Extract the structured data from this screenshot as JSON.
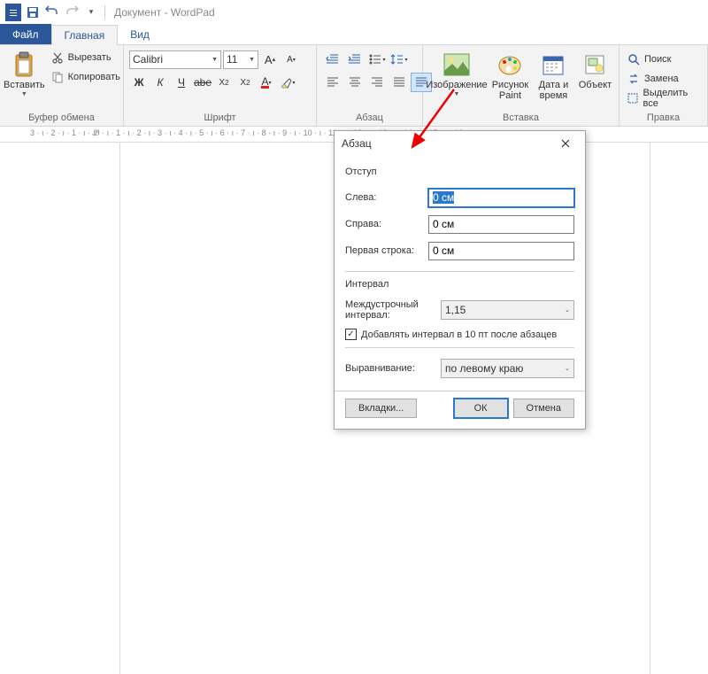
{
  "app": {
    "title": "Документ - WordPad"
  },
  "tabs": {
    "file": "Файл",
    "home": "Главная",
    "view": "Вид"
  },
  "clipboard": {
    "paste": "Вставить",
    "cut": "Вырезать",
    "copy": "Копировать",
    "group": "Буфер обмена"
  },
  "font": {
    "name": "Calibri",
    "size": "11",
    "group": "Шрифт"
  },
  "paragraph": {
    "group": "Абзац"
  },
  "insert": {
    "image": "Изображение",
    "paint": "Рисунок Paint",
    "datetime": "Дата и время",
    "object": "Объект",
    "group": "Вставка"
  },
  "editing": {
    "find": "Поиск",
    "replace": "Замена",
    "selectall": "Выделить все",
    "group": "Правка"
  },
  "ruler": "3 · ı · 2 · ı · 1 · ı · Ꮺ · ı · 1 · ı · 2 · ı · 3 · ı · 4 · ı · 5 · ı · 6 · ı · 7 · ı · 8 · ı · 9 · ı · 10 · ı · 11 · ı · 12 · ı · 13 · ı · 14 · ı · 15 · ı · 16 · ı ·",
  "dialog": {
    "title": "Абзац",
    "indent_section": "Отступ",
    "left_label": "Слева:",
    "left_value": "0 см",
    "right_label": "Справа:",
    "right_value": "0 см",
    "firstline_label": "Первая строка:",
    "firstline_value": "0 см",
    "spacing_section": "Интервал",
    "linespacing_label": "Междустрочный интервал:",
    "linespacing_value": "1,15",
    "addspace_label": "Добавлять интервал в 10 пт после абзацев",
    "align_label": "Выравнивание:",
    "align_value": "по левому краю",
    "tabs_btn": "Вкладки...",
    "ok_btn": "ОК",
    "cancel_btn": "Отмена"
  }
}
